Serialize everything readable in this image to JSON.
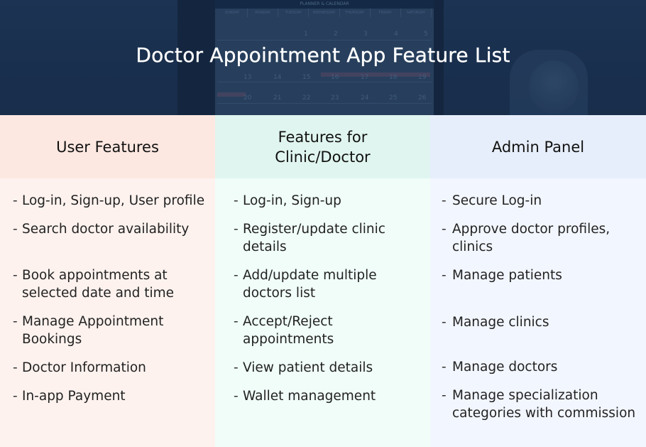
{
  "header": {
    "title": "Doctor Appointment App Feature List",
    "background_image": {
      "calendar_title": "PLANNER & CALENDAR",
      "weekdays": [
        "SUNDAY",
        "MONDAY",
        "TUESDAY",
        "WEDNESDAY",
        "THURSDAY",
        "FRIDAY",
        "SATURDAY"
      ],
      "dates_row1": [
        "1",
        "2",
        "3",
        "4",
        "5"
      ],
      "dates_row2": [
        "13",
        "14",
        "15",
        "16",
        "17",
        "18",
        "19"
      ],
      "dates_row3": [
        "20",
        "21",
        "22",
        "23",
        "24",
        "25",
        "26"
      ]
    }
  },
  "columns": [
    {
      "title": "User Features",
      "items": [
        "Log-in, Sign-up, User profile",
        "Search doctor availability",
        "Book appointments at selected date and time",
        "Manage Appointment Bookings",
        "Doctor Information",
        "In-app Payment"
      ]
    },
    {
      "title": "Features for Clinic/Doctor",
      "items": [
        "Log-in, Sign-up",
        "Register/update clinic details",
        "Add/update multiple doctors list",
        "Accept/Reject appointments",
        "View patient details",
        "Wallet management"
      ]
    },
    {
      "title": "Admin Panel",
      "items": [
        "Secure Log-in",
        "Approve doctor profiles, clinics",
        "Manage patients",
        "Manage clinics",
        "Manage doctors",
        "Manage specialization categories with commission"
      ]
    }
  ],
  "bullet": "-",
  "colors": {
    "hero_bg": "#1e3556",
    "user_header": "#fde8e1",
    "user_body": "#fdf2ee",
    "clinic_header": "#e0f5ef",
    "clinic_body": "#f0fdf9",
    "admin_header": "#e7eefb",
    "admin_body": "#f2f6fe"
  }
}
